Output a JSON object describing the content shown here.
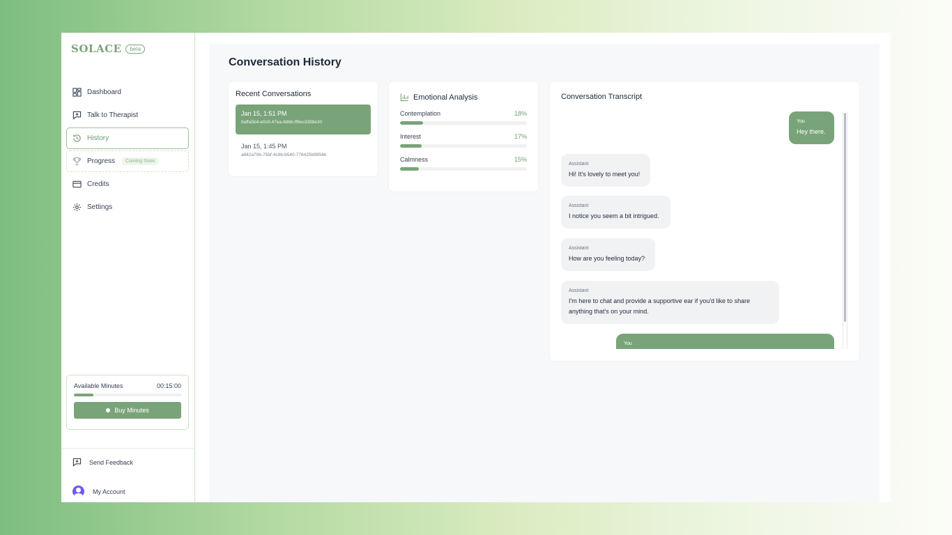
{
  "brand": {
    "name": "SOLACE",
    "badge": "beta"
  },
  "sidebar": {
    "items": [
      {
        "label": "Dashboard",
        "icon": "grid-icon"
      },
      {
        "label": "Talk to Therapist",
        "icon": "chat-plus-icon"
      },
      {
        "label": "History",
        "icon": "history-icon"
      },
      {
        "label": "Progress",
        "icon": "trophy-icon",
        "badge": "Coming Soon"
      },
      {
        "label": "Credits",
        "icon": "card-icon"
      },
      {
        "label": "Settings",
        "icon": "gear-icon"
      }
    ],
    "minutes": {
      "label": "Available Minutes",
      "value": "00:15:00",
      "fill_fraction": 0.18,
      "buy_label": "Buy Minutes"
    },
    "feedback_label": "Send Feedback",
    "account_label": "My Account"
  },
  "main": {
    "title": "Conversation History",
    "recent": {
      "title": "Recent Conversations",
      "items": [
        {
          "date": "Jan 15, 1:51 PM",
          "id": "6affa5b4-e0c0-47ea-8dbb-ff8ec3338e30"
        },
        {
          "date": "Jan 15, 1:45 PM",
          "id": "a842a70b-75bf-4c9b-b540-776425b9954b"
        }
      ]
    },
    "emotion": {
      "title": "Emotional Analysis",
      "items": [
        {
          "name": "Contemplation",
          "pct": "18%",
          "value": 0.18
        },
        {
          "name": "Interest",
          "pct": "17%",
          "value": 0.17
        },
        {
          "name": "Calmness",
          "pct": "15%",
          "value": 0.15
        }
      ]
    },
    "transcript": {
      "title": "Conversation Transcript",
      "messages": [
        {
          "role": "user",
          "who": "You",
          "text": "Hey there."
        },
        {
          "role": "assistant",
          "who": "Assistant",
          "text": "Hi! It's lovely to meet you!"
        },
        {
          "role": "assistant",
          "who": "Assistant",
          "text": "I notice you seem a bit intrigued."
        },
        {
          "role": "assistant",
          "who": "Assistant",
          "text": "How are you feeling today?"
        },
        {
          "role": "assistant",
          "who": "Assistant",
          "text": "I'm here to chat and provide a supportive ear if you'd like to share anything that's on your mind."
        },
        {
          "role": "user",
          "who": "You",
          "text": ""
        }
      ]
    }
  },
  "colors": {
    "accent": "#79a479",
    "accent_dark": "#6d9b6d",
    "avatar": "#6d5cf0"
  }
}
